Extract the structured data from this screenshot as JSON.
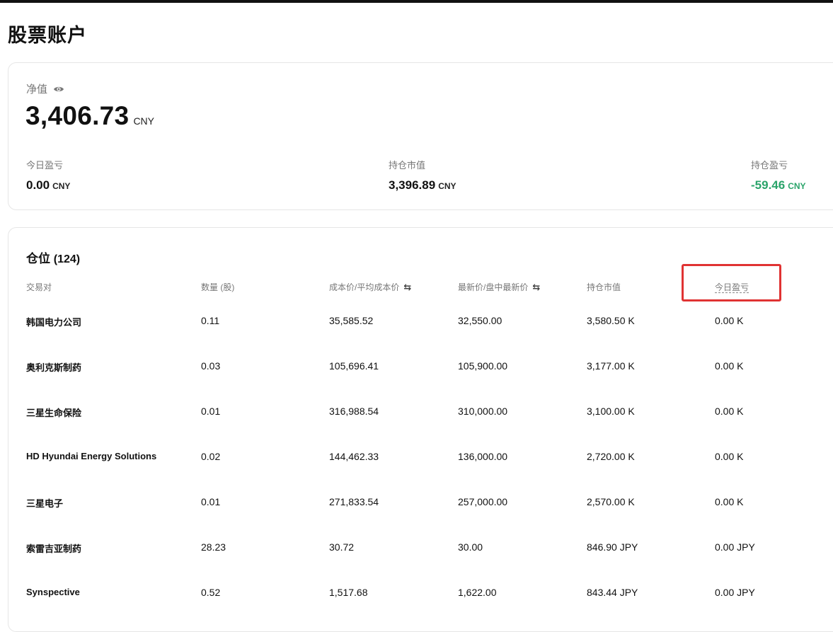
{
  "page": {
    "title": "股票账户"
  },
  "summary": {
    "net_value_label": "净值",
    "net_value": "3,406.73",
    "net_value_unit": "CNY",
    "today_pnl_label": "今日盈亏",
    "today_pnl": "0.00",
    "today_pnl_unit": "CNY",
    "market_value_label": "持仓市值",
    "market_value": "3,396.89",
    "market_value_unit": "CNY",
    "position_pnl_label": "持仓盈亏",
    "position_pnl": "-59.46",
    "position_pnl_unit": "CNY",
    "positive_color": "#2aa46a"
  },
  "positions": {
    "title": "仓位",
    "count": "(124)",
    "headers": {
      "pair": "交易对",
      "quantity": "数量 (股)",
      "cost": "成本价/平均成本价",
      "latest": "最新价/盘中最新价",
      "market_value": "持仓市值",
      "today_pnl": "今日盈亏"
    },
    "rows": [
      {
        "name": "韩国电力公司",
        "qty": "0.11",
        "cost": "35,585.52",
        "latest": "32,550.00",
        "mv": "3,580.50 K",
        "pnl": "0.00 K"
      },
      {
        "name": "奥利克斯制药",
        "qty": "0.03",
        "cost": "105,696.41",
        "latest": "105,900.00",
        "mv": "3,177.00 K",
        "pnl": "0.00 K"
      },
      {
        "name": "三星生命保险",
        "qty": "0.01",
        "cost": "316,988.54",
        "latest": "310,000.00",
        "mv": "3,100.00 K",
        "pnl": "0.00 K"
      },
      {
        "name": "HD Hyundai Energy Solutions",
        "qty": "0.02",
        "cost": "144,462.33",
        "latest": "136,000.00",
        "mv": "2,720.00 K",
        "pnl": "0.00 K"
      },
      {
        "name": "三星电子",
        "qty": "0.01",
        "cost": "271,833.54",
        "latest": "257,000.00",
        "mv": "2,570.00 K",
        "pnl": "0.00 K"
      },
      {
        "name": "索雷吉亚制药",
        "qty": "28.23",
        "cost": "30.72",
        "latest": "30.00",
        "mv": "846.90 JPY",
        "pnl": "0.00 JPY"
      },
      {
        "name": "Synspective",
        "qty": "0.52",
        "cost": "1,517.68",
        "latest": "1,622.00",
        "mv": "843.44 JPY",
        "pnl": "0.00 JPY"
      }
    ]
  }
}
